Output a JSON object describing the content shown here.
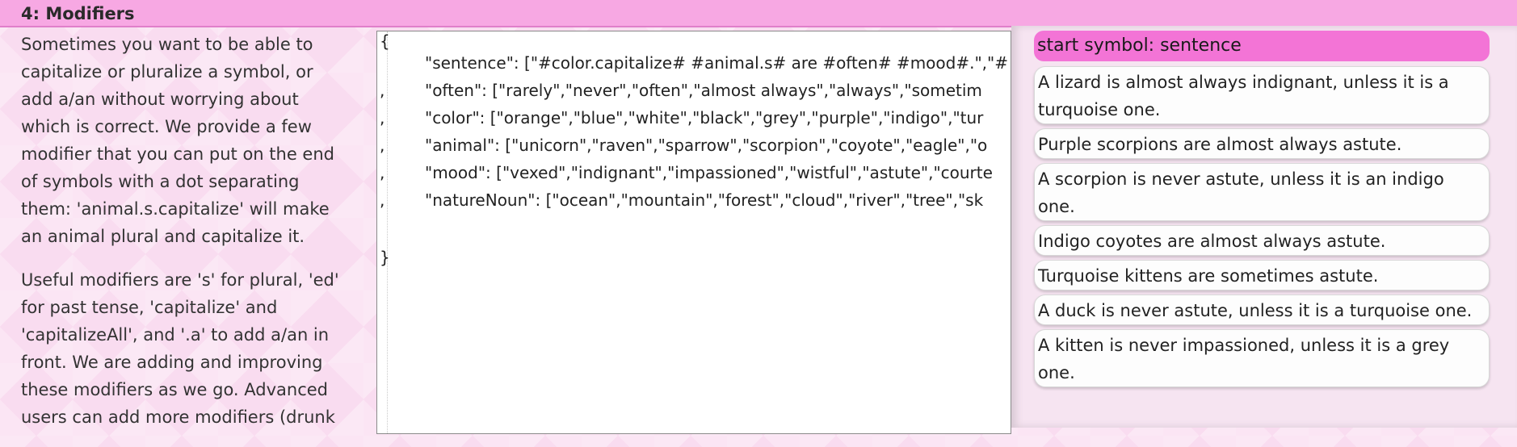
{
  "header": {
    "title": "4: Modifiers"
  },
  "description": {
    "p1_lines": [
      "Sometimes you want to be able to",
      "capitalize or pluralize a symbol, or",
      "add a/an without worrying about",
      "which is correct. We provide a few",
      "modifier that you can put on the end",
      "of symbols with a dot separating",
      "them: 'animal.s.capitalize' will make",
      "an animal plural and capitalize it."
    ],
    "p2_lines": [
      "Useful modifiers are 's' for plural, 'ed'",
      "for past tense, 'capitalize' and",
      "'capitalizeAll', and '.a' to add a/an in",
      "front. We are adding and improving",
      "these modifiers as we go. Advanced",
      "users can add more modifiers (drunk"
    ]
  },
  "editor": {
    "open_brace": "{",
    "close_brace": "}",
    "lines": [
      "\"sentence\": [\"#color.capitalize# #animal.s# are #often# #mood#.\",\"#",
      "\"often\": [\"rarely\",\"never\",\"often\",\"almost always\",\"always\",\"sometim",
      "\"color\": [\"orange\",\"blue\",\"white\",\"black\",\"grey\",\"purple\",\"indigo\",\"tur",
      "\"animal\": [\"unicorn\",\"raven\",\"sparrow\",\"scorpion\",\"coyote\",\"eagle\",\"o",
      "\"mood\": [\"vexed\",\"indignant\",\"impassioned\",\"wistful\",\"astute\",\"courte",
      "\"natureNoun\": [\"ocean\",\"mountain\",\"forest\",\"cloud\",\"river\",\"tree\",\"sk"
    ],
    "line_prefixes": [
      "",
      ",",
      ",",
      ",",
      ",",
      ","
    ]
  },
  "output": {
    "start_symbol": "start symbol: sentence",
    "results": [
      [
        "A lizard is almost always indignant, unless it is a",
        "turquoise one."
      ],
      [
        "Purple scorpions are almost always astute."
      ],
      [
        "A scorpion is never astute, unless it is an indigo",
        "one."
      ],
      [
        "Indigo coyotes are almost always astute."
      ],
      [
        "Turquoise kittens are sometimes astute."
      ],
      [
        "A duck is never astute, unless it is a turquoise one."
      ],
      [
        "A kitten is never impassioned, unless it is a grey",
        "one."
      ]
    ]
  }
}
